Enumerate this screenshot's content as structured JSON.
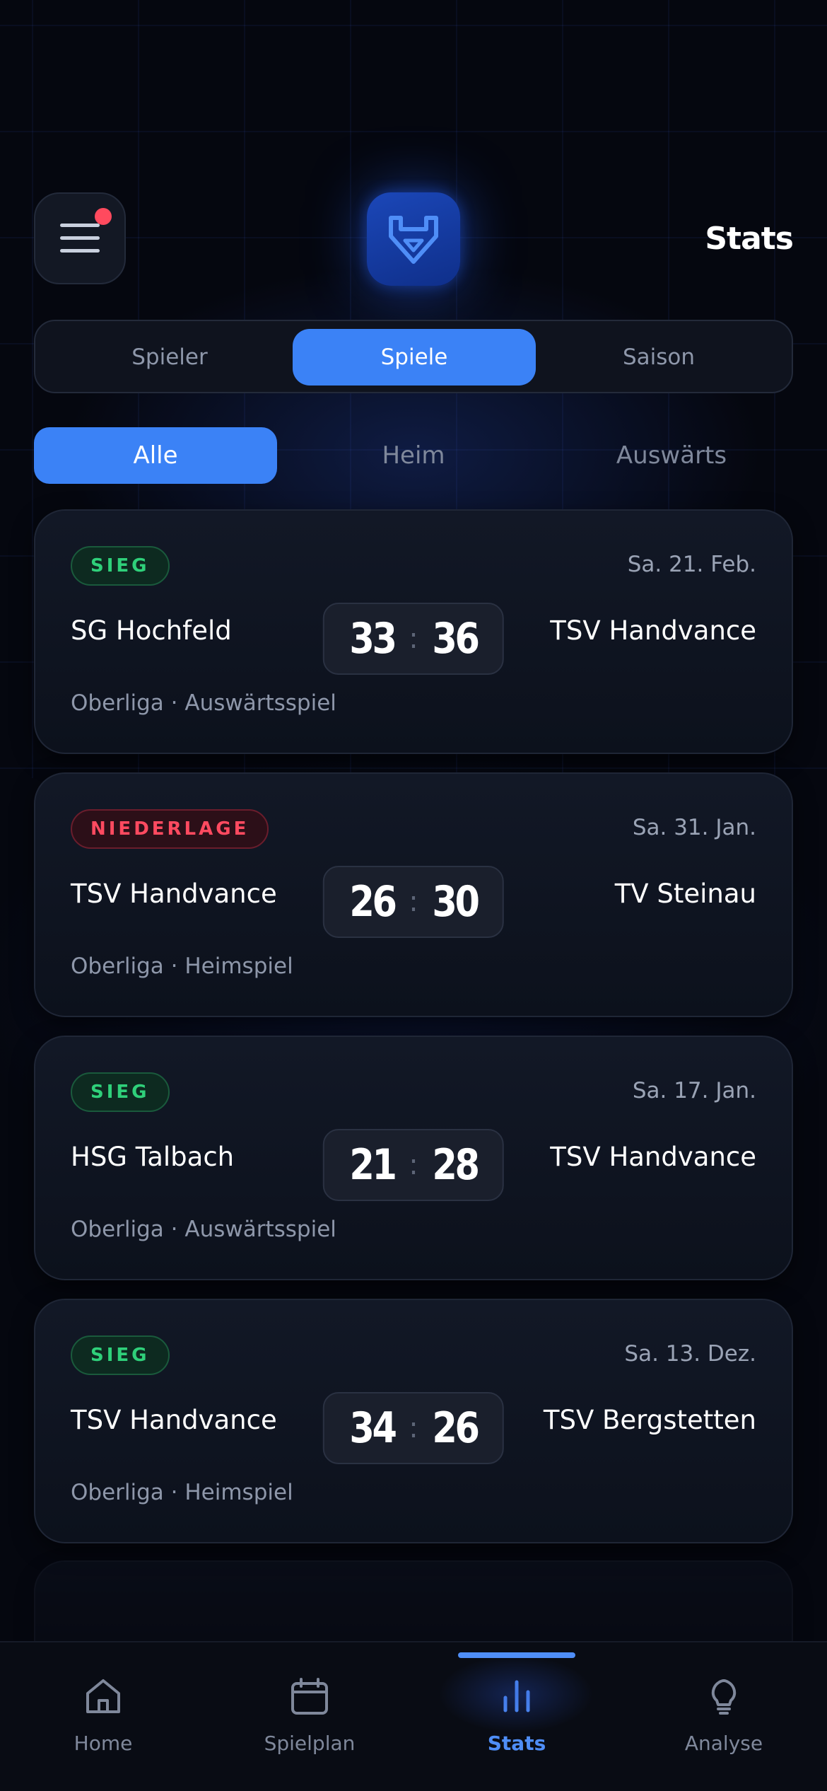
{
  "header": {
    "title": "Stats",
    "menu_icon": "hamburger-menu-icon",
    "notification_color": "#ff4a5e",
    "logo_icon": "handvance-shield-icon",
    "accent": "#3b82f6"
  },
  "segments": [
    {
      "label": "Spieler",
      "active": false
    },
    {
      "label": "Spiele",
      "active": true
    },
    {
      "label": "Saison",
      "active": false
    }
  ],
  "filters": [
    {
      "label": "Alle",
      "active": true
    },
    {
      "label": "Heim",
      "active": false
    },
    {
      "label": "Auswärts",
      "active": false
    }
  ],
  "games": [
    {
      "result": "SIEG",
      "result_type": "win",
      "date": "Sa. 21. Feb.",
      "home": "SG Hochfeld",
      "score_home": "33",
      "score_away": "36",
      "away": "TSV Handvance",
      "meta": "Oberliga · Auswärtsspiel"
    },
    {
      "result": "NIEDERLAGE",
      "result_type": "loss",
      "date": "Sa. 31. Jan.",
      "home": "TSV Handvance",
      "score_home": "26",
      "score_away": "30",
      "away": "TV Steinau",
      "meta": "Oberliga · Heimspiel"
    },
    {
      "result": "SIEG",
      "result_type": "win",
      "date": "Sa. 17. Jan.",
      "home": "HSG Talbach",
      "score_home": "21",
      "score_away": "28",
      "away": "TSV Handvance",
      "meta": "Oberliga · Auswärtsspiel"
    },
    {
      "result": "SIEG",
      "result_type": "win",
      "date": "Sa. 13. Dez.",
      "home": "TSV Handvance",
      "score_home": "34",
      "score_away": "26",
      "away": "TSV Bergstetten",
      "meta": "Oberliga · Heimspiel"
    }
  ],
  "score_separator": ":",
  "bottom_nav": [
    {
      "label": "Home",
      "icon": "home-icon",
      "active": false
    },
    {
      "label": "Spielplan",
      "icon": "calendar-icon",
      "active": false
    },
    {
      "label": "Stats",
      "icon": "bar-chart-icon",
      "active": true
    },
    {
      "label": "Analyse",
      "icon": "lightbulb-icon",
      "active": false
    }
  ]
}
